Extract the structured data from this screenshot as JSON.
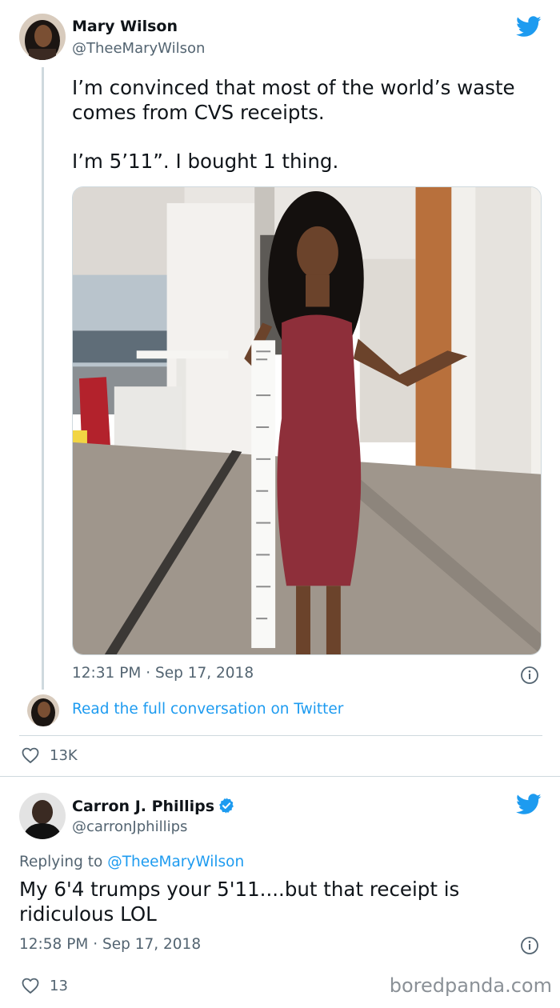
{
  "tweet1": {
    "author_name": "Mary Wilson",
    "author_handle": "@TheeMaryWilson",
    "text_lines": [
      "I’m convinced that most of the world’s waste",
      "comes from CVS receipts.",
      "I’m 5’11”. I bought 1 thing."
    ],
    "timestamp": "12:31 PM · Sep 17, 2018",
    "read_more_link": "Read the full conversation on Twitter",
    "like_count": "13K"
  },
  "tweet2": {
    "author_name": "Carron J. Phillips",
    "author_handle": "@carronJphillips",
    "replying_prefix": "Replying to ",
    "replying_handle": "@TheeMaryWilson",
    "text_lines": [
      "My 6'4 trumps your 5'11....but that receipt is",
      "ridiculous LOL"
    ],
    "timestamp": "12:58 PM · Sep 17, 2018",
    "like_count": "13"
  },
  "watermark": "boredpanda.com",
  "icons": {
    "brand": "twitter-bird-icon",
    "like": "heart-icon",
    "info": "info-icon",
    "verified": "verified-badge-icon"
  },
  "colors": {
    "link": "#1d9bf0",
    "text": "#0f1419",
    "secondary": "#536471",
    "divider": "#cfd9de"
  }
}
